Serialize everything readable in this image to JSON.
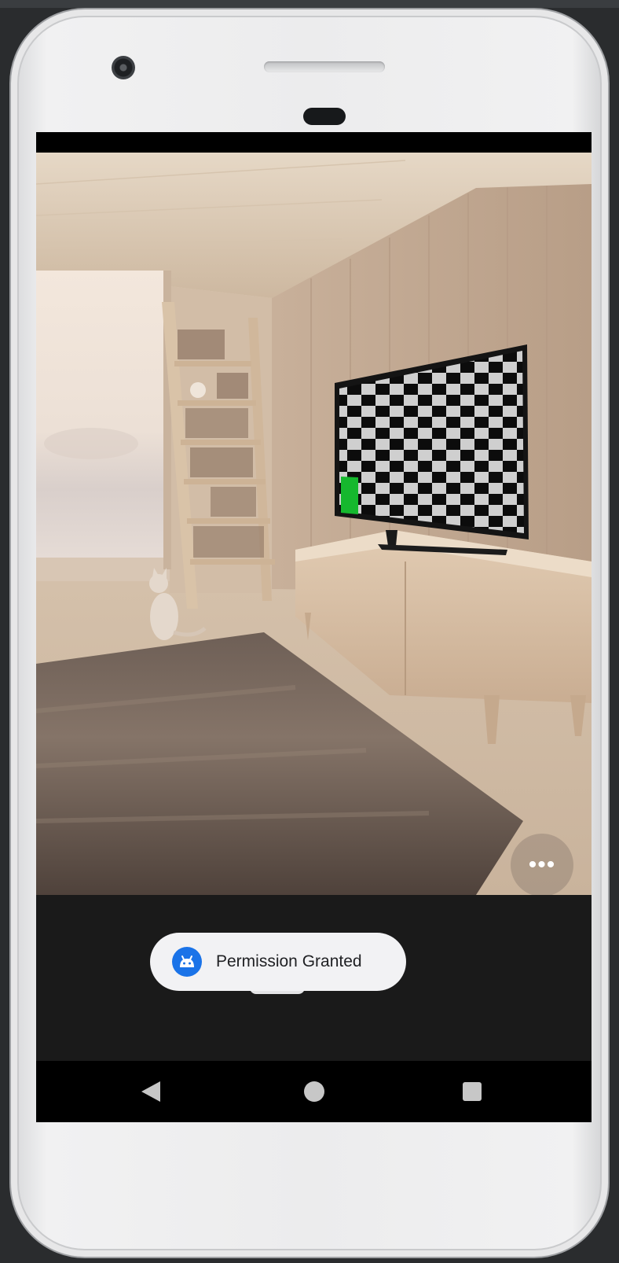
{
  "toast": {
    "icon": "android-robot-icon",
    "message": "Permission Granted"
  },
  "photo": {
    "more_label": "•••",
    "more_icon": "more-horizontal-icon"
  },
  "navigation": {
    "back_icon": "back-triangle-icon",
    "home_icon": "home-circle-icon",
    "recents_icon": "recents-square-icon"
  },
  "colors": {
    "toast_icon_bg": "#1a73e8",
    "tv_green_marker": "#16b82e",
    "screen_bg": "#1a1a1a"
  }
}
